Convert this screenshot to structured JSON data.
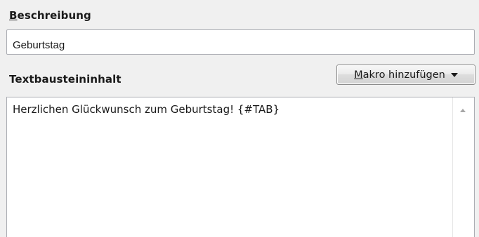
{
  "description": {
    "label_mnemonic": "B",
    "label_rest": "eschreibung",
    "value": "Geburtstag"
  },
  "content": {
    "label": "Textbausteininhalt",
    "text": "Herzlichen Glückwunsch zum Geburtstag! {#TAB}"
  },
  "macro_button": {
    "label_mnemonic": "M",
    "label_rest": "akro hinzufügen",
    "icon": "chevron-down-icon"
  },
  "scrollbar": {
    "icon": "scroll-up-arrow-icon"
  }
}
